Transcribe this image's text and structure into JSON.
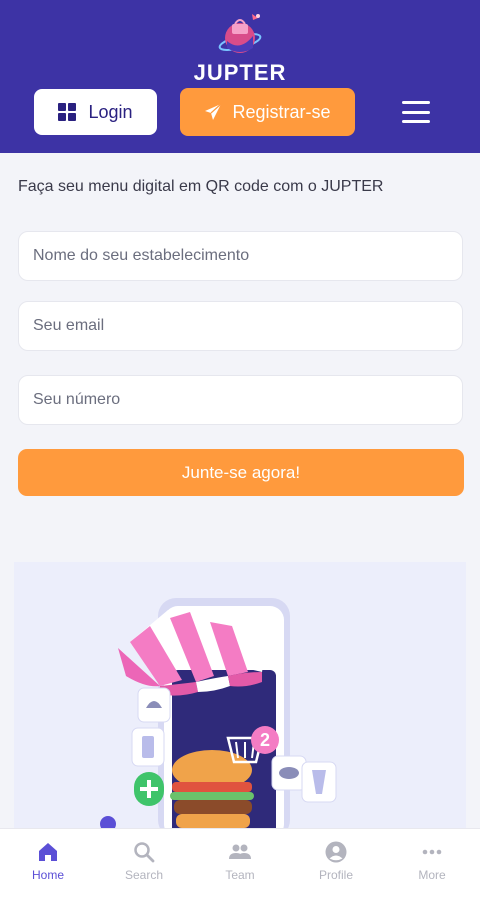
{
  "header": {
    "logo_text": "JUPTER",
    "login_label": "Login",
    "register_label": "Registrar-se"
  },
  "form": {
    "intro": "Faça seu menu digital em QR code com o JUPTER",
    "name_placeholder": "Nome do seu estabelecimento",
    "email_placeholder": "Seu email",
    "phone_placeholder": "Seu número",
    "submit_label": "Junte-se agora!"
  },
  "illustration": {
    "cart_badge": "2"
  },
  "bottom_nav": {
    "items": [
      {
        "label": "Home",
        "icon": "home-icon",
        "active": true
      },
      {
        "label": "Search",
        "icon": "search-icon",
        "active": false
      },
      {
        "label": "Team",
        "icon": "team-icon",
        "active": false
      },
      {
        "label": "Profile",
        "icon": "profile-icon",
        "active": false
      },
      {
        "label": "More",
        "icon": "more-icon",
        "active": false
      }
    ]
  },
  "colors": {
    "header_bg": "#3d33a5",
    "accent_orange": "#ff9a3d",
    "active_nav": "#5b4fd6",
    "inactive_nav": "#b3b4be",
    "page_bg": "#f3f4f9"
  }
}
